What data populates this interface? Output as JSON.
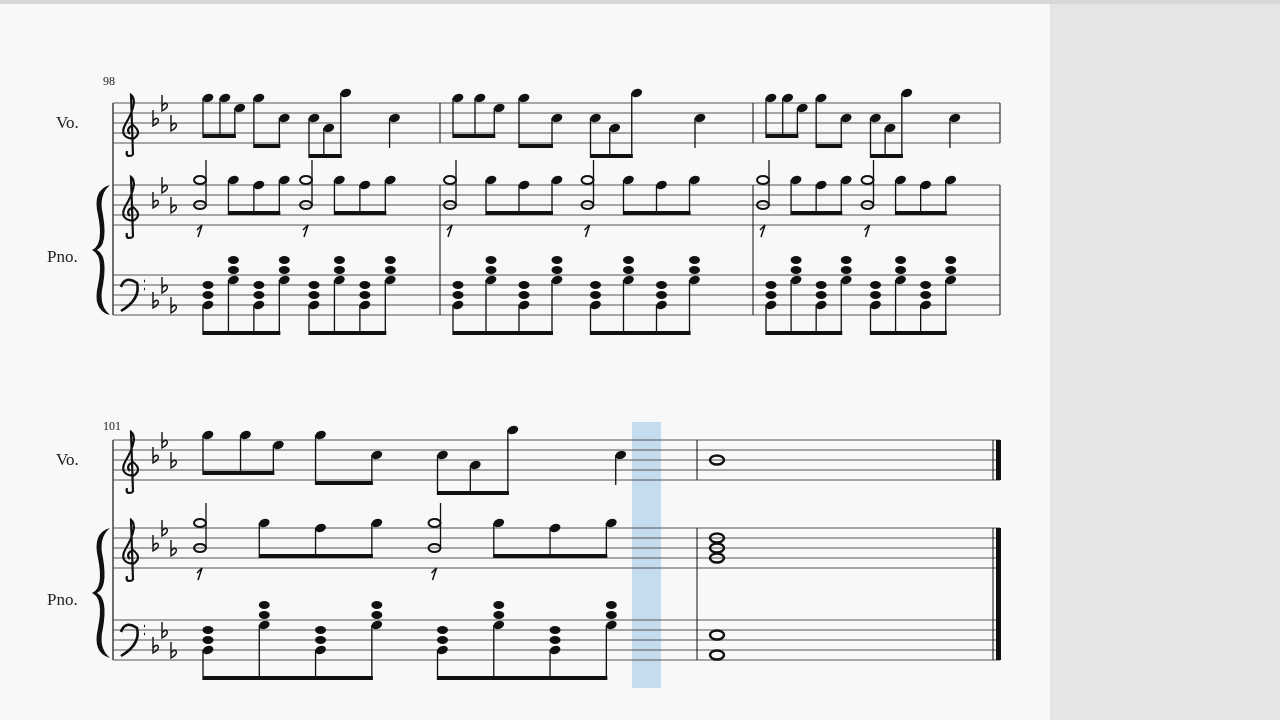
{
  "score": {
    "systems": [
      {
        "measure_number": "98",
        "staff_labels": [
          "Vo.",
          "Pno."
        ]
      },
      {
        "measure_number": "101",
        "staff_labels": [
          "Vo.",
          "Pno."
        ]
      }
    ]
  }
}
